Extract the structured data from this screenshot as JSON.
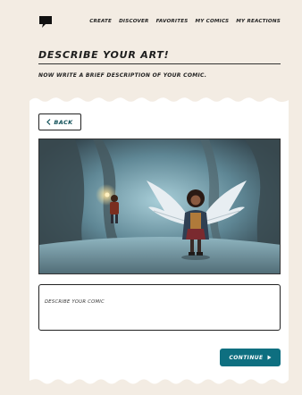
{
  "nav": {
    "logo_icon": "speech-bubble-icon",
    "links": [
      "CREATE",
      "DISCOVER",
      "FAVORITES",
      "MY COMICS",
      "MY REACTIONS"
    ]
  },
  "page": {
    "heading": "DESCRIBE YOUR ART!",
    "subheading": "NOW WRITE A BRIEF DESCRIPTION OF YOUR COMIC."
  },
  "card": {
    "back_label": "BACK",
    "back_icon": "chevron-left-icon",
    "artwork_icon": "generated-comic-image",
    "description_placeholder": "DESCRIBE YOUR COMIC",
    "description_value": "",
    "continue_label": "CONTINUE",
    "continue_icon": "play-triangle-icon"
  },
  "colors": {
    "background": "#f3ece3",
    "card": "#ffffff",
    "accent": "#0e6f80",
    "back_text": "#0f4f57"
  }
}
